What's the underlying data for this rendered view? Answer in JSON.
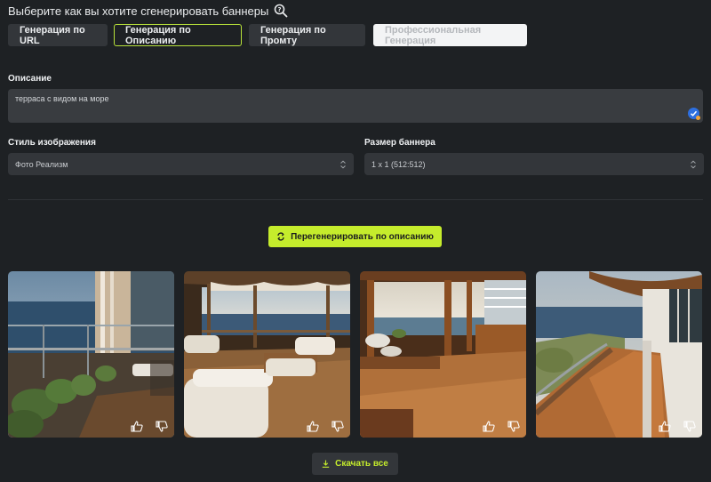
{
  "header": {
    "title": "Выберите как вы хотите сгенерировать баннеры"
  },
  "mode_tabs": [
    {
      "label": "Генерация по URL",
      "state": "default"
    },
    {
      "label": "Генерация по Описанию",
      "state": "active"
    },
    {
      "label": "Генерация по Промту",
      "state": "default"
    },
    {
      "label": "Профессиональная Генерация",
      "state": "disabled"
    }
  ],
  "description": {
    "label": "Описание",
    "value": "терраса с видом на море"
  },
  "image_style": {
    "label": "Стиль изображения",
    "selected": "Фото Реализм"
  },
  "banner_size": {
    "label": "Размер баннера",
    "selected": "1 x 1 (512:512)"
  },
  "regenerate": {
    "label": "Перегенерировать по описанию"
  },
  "gallery": {
    "images": [
      {
        "subject": "terrace-sea-view-1"
      },
      {
        "subject": "terrace-sea-view-2"
      },
      {
        "subject": "terrace-sea-view-3"
      },
      {
        "subject": "terrace-sea-view-4"
      }
    ]
  },
  "download": {
    "label": "Скачать все"
  },
  "colors": {
    "background": "#1e2124",
    "surface": "#33363a",
    "accent": "#c5ec2c"
  }
}
